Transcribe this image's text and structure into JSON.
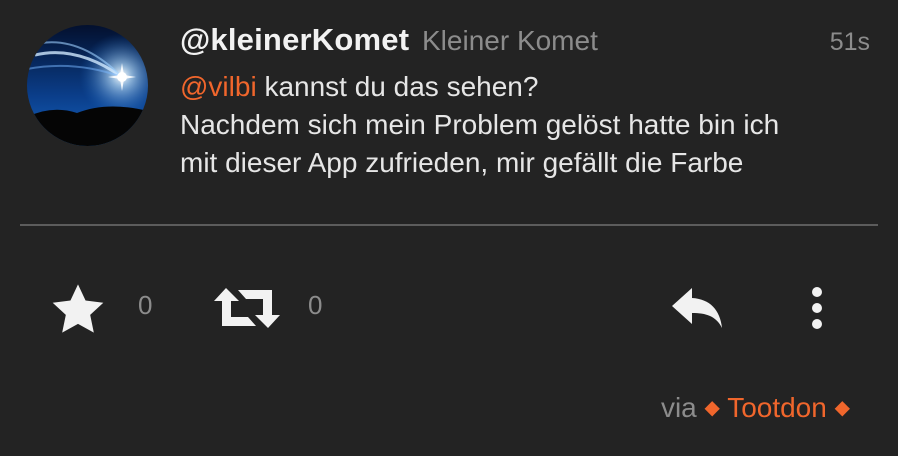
{
  "status": {
    "display_name": "@kleinerKomet",
    "username": "Kleiner Komet",
    "timestamp": "51s",
    "mention": "@vilbi",
    "text_line1_rest": " kannst du das sehen?",
    "text_line2": "Nachdem sich mein Problem gelöst hatte bin ich",
    "text_line3": "mit dieser App zufrieden, mir gefällt die Farbe"
  },
  "actions": {
    "favourite_count": "0",
    "boost_count": "0",
    "icons": [
      "star-icon",
      "boost-icon",
      "reply-icon",
      "more-vertical-icon"
    ]
  },
  "footer": {
    "via_label": "via",
    "app_name": "Tootdon",
    "diamond": "◆"
  },
  "colors": {
    "background": "#232323",
    "accent": "#f0662c",
    "muted": "#8c8c8c",
    "text": "#e6e6e6"
  }
}
